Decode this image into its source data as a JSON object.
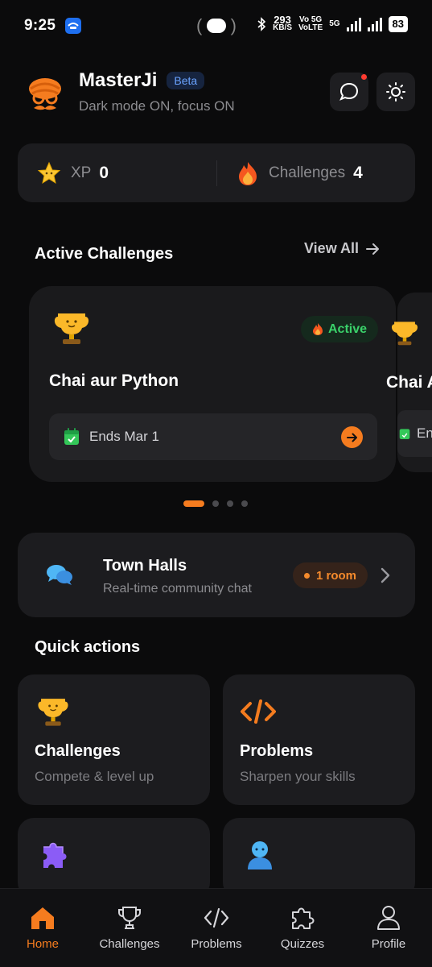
{
  "status_bar": {
    "time": "9:25",
    "speed_value": "293",
    "speed_unit": "KB/S",
    "net_top": "Vo 5G",
    "net_bottom": "VoLTE",
    "net_5g": "5G",
    "battery": "83"
  },
  "header": {
    "brand": "MasterJi",
    "badge": "Beta",
    "status": "Dark mode ON, focus ON",
    "icons": [
      "chat-icon",
      "sun-icon"
    ]
  },
  "stats": {
    "xp_label": "XP",
    "xp_value": "0",
    "challenges_label": "Challenges",
    "challenges_value": "4"
  },
  "active_challenges": {
    "title": "Active Challenges",
    "view_all": "View All",
    "cards": [
      {
        "name": "Chai aur Python",
        "status": "Active",
        "ends": "Ends Mar 1"
      },
      {
        "name": "Chai A",
        "ends": "En"
      }
    ],
    "pager_total": 4,
    "pager_active": 0
  },
  "town_halls": {
    "title": "Town Halls",
    "subtitle": "Real-time community chat",
    "rooms": "1 room"
  },
  "quick_actions": {
    "title": "Quick actions",
    "items": [
      {
        "title": "Challenges",
        "subtitle": "Compete & level up",
        "icon": "trophy-icon"
      },
      {
        "title": "Problems",
        "subtitle": "Sharpen your skills",
        "icon": "code-icon"
      },
      {
        "title": "",
        "subtitle": "",
        "icon": "puzzle-icon"
      },
      {
        "title": "",
        "subtitle": "",
        "icon": "person-icon"
      }
    ]
  },
  "nav": {
    "items": [
      {
        "label": "Home",
        "icon": "home-icon",
        "active": true
      },
      {
        "label": "Challenges",
        "icon": "trophy-outline-icon"
      },
      {
        "label": "Problems",
        "icon": "code-icon"
      },
      {
        "label": "Quizzes",
        "icon": "puzzle-icon"
      },
      {
        "label": "Profile",
        "icon": "user-icon"
      }
    ]
  },
  "colors": {
    "accent": "#f57c1f",
    "background": "#0b0b0c",
    "card": "#1c1c1f",
    "active_green": "#3ad16a",
    "beta_blue": "#6aa3ff"
  }
}
